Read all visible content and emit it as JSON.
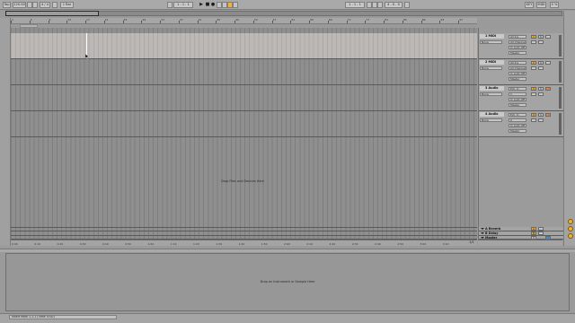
{
  "transport": {
    "tap": "Tap",
    "tempo": "120.00",
    "meter": "4 / 4",
    "quantize": "1 Bar",
    "position": "1 . 1 . 1",
    "loop_start": "1 . 1 . 1",
    "loop_length": "4 . 0 . 0",
    "right_key": "KEY",
    "right_midi": "MIDI",
    "right_cpu": "0 %"
  },
  "ruler": {
    "bars": [
      "1",
      "5",
      "9",
      "13",
      "17",
      "21",
      "25",
      "29",
      "33",
      "37",
      "41",
      "45",
      "49",
      "53",
      "57",
      "61",
      "65",
      "69",
      "73",
      "77",
      "81",
      "85",
      "89",
      "93",
      "97"
    ],
    "time_labels": [
      "0:00",
      "0:10",
      "0:20",
      "0:30",
      "0:40",
      "0:50",
      "1:00",
      "1:10",
      "1:20",
      "1:30",
      "1:40",
      "1:50",
      "2:00",
      "2:10",
      "2:20",
      "2:30",
      "2:40",
      "2:50",
      "3:00",
      "3:10"
    ]
  },
  "arrangement": {
    "drop_hint": "Drop Files and Devices Here"
  },
  "tracks": [
    {
      "name": "1 MIDI",
      "input": "All Ins",
      "channel": "All Channels",
      "monitor": "In Auto Off",
      "output": "Master",
      "number": "1",
      "type": "midi"
    },
    {
      "name": "2 MIDI",
      "input": "All Ins",
      "channel": "All Channels",
      "monitor": "In Auto Off",
      "output": "Master",
      "number": "2",
      "type": "midi"
    },
    {
      "name": "3 Audio",
      "input": "Ext. In",
      "channel": "1",
      "monitor": "In Auto Off",
      "output": "Master",
      "number": "3",
      "type": "audio"
    },
    {
      "name": "4 Audio",
      "input": "Ext. In",
      "channel": "2",
      "monitor": "In Auto Off",
      "output": "Master",
      "number": "4",
      "type": "audio"
    }
  ],
  "returns": [
    {
      "name": "A Reverb",
      "letter": "A"
    },
    {
      "name": "B Delay",
      "letter": "B"
    }
  ],
  "master": {
    "name": "Master",
    "value": "0"
  },
  "zoom": "1/1",
  "detail": {
    "drop_hint": "Drop an Instrument or Sample Here"
  },
  "status": {
    "text": "Insert Mark 1.1.1 (Time: 0:00)"
  },
  "colors": {
    "accent_yellow": "#f1b22c",
    "accent_orange": "#e3813b",
    "accent_blue": "#3b8fd6",
    "panel_grey": "#a4a4a4"
  }
}
